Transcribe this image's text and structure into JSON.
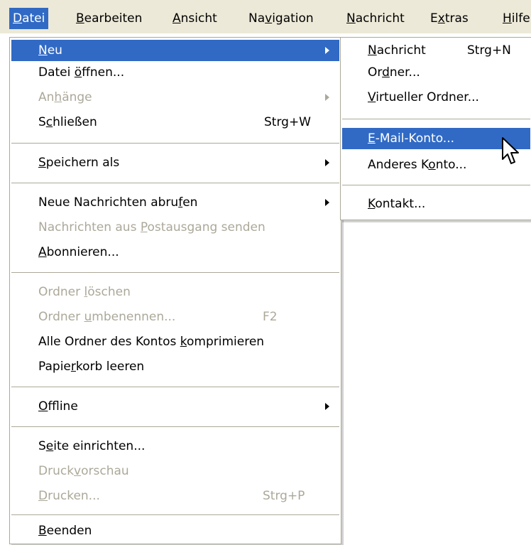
{
  "menubar": {
    "items": [
      {
        "prefix": "",
        "hotkey": "D",
        "suffix": "atei"
      },
      {
        "prefix": "",
        "hotkey": "B",
        "suffix": "earbeiten"
      },
      {
        "prefix": "",
        "hotkey": "A",
        "suffix": "nsicht"
      },
      {
        "prefix": "Na",
        "hotkey": "v",
        "suffix": "igation"
      },
      {
        "prefix": "",
        "hotkey": "N",
        "suffix": "achricht"
      },
      {
        "prefix": "E",
        "hotkey": "x",
        "suffix": "tras"
      },
      {
        "prefix": "",
        "hotkey": "H",
        "suffix": "ilfe"
      }
    ]
  },
  "file_menu": {
    "neu": {
      "prefix": "",
      "hotkey": "N",
      "suffix": "eu"
    },
    "datei_oeffnen": {
      "prefix": "Datei ",
      "hotkey": "ö",
      "suffix": "ffnen..."
    },
    "anhaenge": {
      "prefix": "An",
      "hotkey": "h",
      "suffix": "änge"
    },
    "schliessen": {
      "prefix": "S",
      "hotkey": "c",
      "suffix": "hließen",
      "shortcut": "Strg+W"
    },
    "speichern_als": {
      "prefix": "",
      "hotkey": "S",
      "suffix": "peichern als"
    },
    "neue_nachrichten": {
      "prefix": "Neue Nachrichten abru",
      "hotkey": "f",
      "suffix": "en"
    },
    "nachrichten_senden": {
      "prefix": "Nachrichten aus ",
      "hotkey": "P",
      "suffix": "ostausgang senden"
    },
    "abonnieren": {
      "prefix": "",
      "hotkey": "A",
      "suffix": "bonnieren..."
    },
    "ordner_loeschen": {
      "prefix": "Ordner ",
      "hotkey": "l",
      "suffix": "öschen"
    },
    "ordner_umbenennen": {
      "prefix": "Ordner ",
      "hotkey": "u",
      "suffix": "mbenennen...",
      "shortcut": "F2"
    },
    "ordner_komprimieren": {
      "prefix": "Alle Ordner des Kontos ",
      "hotkey": "k",
      "suffix": "omprimieren"
    },
    "papierkorb": {
      "prefix": "Papie",
      "hotkey": "r",
      "suffix": "korb leeren"
    },
    "offline": {
      "prefix": "",
      "hotkey": "O",
      "suffix": "ffline"
    },
    "seite_einrichten": {
      "prefix": "S",
      "hotkey": "e",
      "suffix": "ite einrichten..."
    },
    "druckvorschau": {
      "prefix": "Druck",
      "hotkey": "v",
      "suffix": "orschau"
    },
    "drucken": {
      "prefix": "",
      "hotkey": "D",
      "suffix": "rucken...",
      "shortcut": "Strg+P"
    },
    "beenden": {
      "prefix": "",
      "hotkey": "B",
      "suffix": "eenden"
    }
  },
  "submenu_neu": {
    "nachricht": {
      "prefix": "",
      "hotkey": "N",
      "suffix": "achricht",
      "shortcut": "Strg+N"
    },
    "ordner": {
      "prefix": "Or",
      "hotkey": "d",
      "suffix": "ner..."
    },
    "virtueller_ordner": {
      "prefix": "",
      "hotkey": "V",
      "suffix": "irtueller Ordner..."
    },
    "email_konto": {
      "prefix": "",
      "hotkey": "E",
      "suffix": "-Mail-Konto..."
    },
    "anderes_konto": {
      "prefix": "Anderes K",
      "hotkey": "o",
      "suffix": "nto..."
    },
    "kontakt": {
      "prefix": "",
      "hotkey": "K",
      "suffix": "ontakt..."
    }
  },
  "colors": {
    "highlight": "#316ac5",
    "disabled": "#aca899",
    "menubar_bg": "#ece9d8"
  },
  "icons": {
    "submenu_arrow": "triangle-right",
    "pointer": "mouse-pointer-arrow"
  }
}
